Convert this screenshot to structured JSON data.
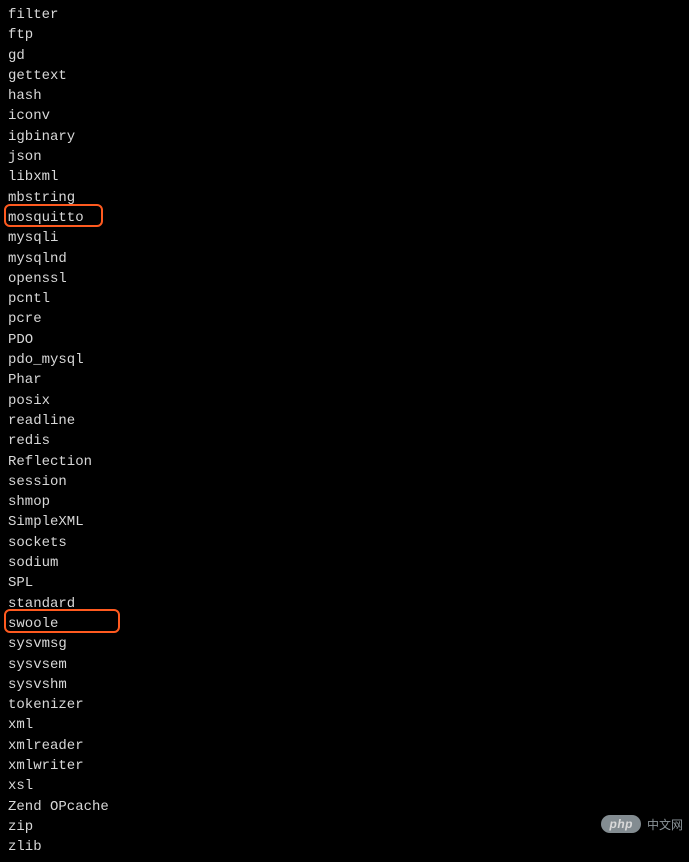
{
  "terminal": {
    "lines": [
      "filter",
      "ftp",
      "gd",
      "gettext",
      "hash",
      "iconv",
      "igbinary",
      "json",
      "libxml",
      "mbstring",
      "mosquitto",
      "mysqli",
      "mysqlnd",
      "openssl",
      "pcntl",
      "pcre",
      "PDO",
      "pdo_mysql",
      "Phar",
      "posix",
      "readline",
      "redis",
      "Reflection",
      "session",
      "shmop",
      "SimpleXML",
      "sockets",
      "sodium",
      "SPL",
      "standard",
      "swoole",
      "sysvmsg",
      "sysvsem",
      "sysvshm",
      "tokenizer",
      "xml",
      "xmlreader",
      "xmlwriter",
      "xsl",
      "Zend OPcache",
      "zip",
      "zlib"
    ]
  },
  "highlighted": [
    "mosquitto",
    "swoole"
  ],
  "watermark": {
    "badge": "php",
    "text": "中文网"
  }
}
